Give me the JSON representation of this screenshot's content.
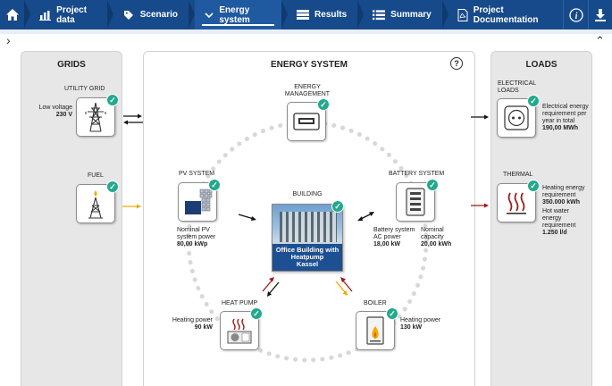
{
  "nav": {
    "items": [
      {
        "label": "Project data",
        "icon": "chart-icon"
      },
      {
        "label": "Scenario",
        "icon": "tag-icon"
      },
      {
        "label": "Energy system",
        "icon": "chevron-down-icon"
      },
      {
        "label": "Results",
        "icon": "table-icon"
      },
      {
        "label": "Summary",
        "icon": "list-icon"
      },
      {
        "label": "Project Documentation",
        "icon": "pdf-icon"
      }
    ],
    "active_index": 2
  },
  "grids": {
    "title": "GRIDS",
    "utility_grid": {
      "label": "UTILITY GRID",
      "desc": "Low voltage",
      "value": "230 V"
    },
    "fuel": {
      "label": "FUEL"
    }
  },
  "energy_system": {
    "title": "ENERGY SYSTEM",
    "energy_management": {
      "label_line1": "ENERGY",
      "label_line2": "MANAGEMENT"
    },
    "pv_system": {
      "label": "PV SYSTEM",
      "desc_line1": "Nominal PV",
      "desc_line2": "system power",
      "value": "80,00 kWp"
    },
    "battery_system": {
      "label": "BATTERY SYSTEM",
      "desc1_line1": "Battery system",
      "desc1_line2": "AC power",
      "value1": "18,00 kW",
      "desc2_line1": "Nominal",
      "desc2_line2": "capacity",
      "value2": "20,00 kWh"
    },
    "building": {
      "label": "BUILDING",
      "caption_line1": "Office Building with",
      "caption_line2": "Heatpump",
      "caption_line3": "Kassel"
    },
    "heat_pump": {
      "label": "HEAT PUMP",
      "desc": "Heating power",
      "value": "90 kW"
    },
    "boiler": {
      "label": "BOILER",
      "desc": "Heating power",
      "value": "130 kW"
    }
  },
  "loads": {
    "title": "LOADS",
    "electrical": {
      "label_line1": "ELECTRICAL",
      "label_line2": "LOADS",
      "desc_line1": "Electrical energy",
      "desc_line2": "requirement per",
      "desc_line3": "year in total",
      "value": "190,00 MWh"
    },
    "thermal": {
      "label": "THERMAL",
      "desc1_line1": "Heating energy",
      "desc1_line2": "requirement",
      "value1": "350.000 kWh",
      "desc2_line1": "Hot water",
      "desc2_line2": "energy",
      "desc2_line3": "requirement",
      "value2": "1.250 l/d"
    }
  },
  "colors": {
    "nav_bg": "#174a8a",
    "check_green": "#23a98c",
    "fuel_arrow": "#f2a900",
    "thermal_arrow": "#a01818",
    "electric_arrow": "#111111"
  }
}
